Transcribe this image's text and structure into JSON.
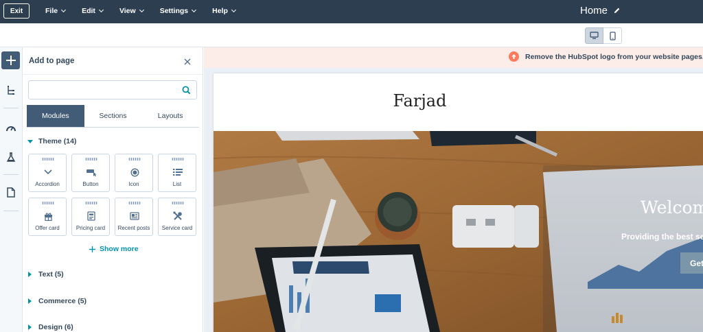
{
  "topbar": {
    "exit_label": "Exit",
    "menu": [
      {
        "label": "File"
      },
      {
        "label": "Edit"
      },
      {
        "label": "View"
      },
      {
        "label": "Settings"
      },
      {
        "label": "Help"
      }
    ],
    "page_title": "Home"
  },
  "panel": {
    "title": "Add to page",
    "search_value": "",
    "tabs": [
      {
        "label": "Modules",
        "active": true
      },
      {
        "label": "Sections",
        "active": false
      },
      {
        "label": "Layouts",
        "active": false
      }
    ],
    "theme_group": {
      "label": "Theme (14)",
      "expanded": true
    },
    "modules": [
      {
        "label": "Accordion",
        "icon": "chevron-down-icon"
      },
      {
        "label": "Button",
        "icon": "button-cursor-icon"
      },
      {
        "label": "Icon",
        "icon": "target-icon"
      },
      {
        "label": "List",
        "icon": "list-icon"
      },
      {
        "label": "Offer card",
        "icon": "gift-icon"
      },
      {
        "label": "Pricing card",
        "icon": "price-tag-icon"
      },
      {
        "label": "Recent posts",
        "icon": "posts-icon"
      },
      {
        "label": "Service card",
        "icon": "tools-icon"
      }
    ],
    "show_more_label": "Show more",
    "groups": [
      {
        "label": "Text (5)"
      },
      {
        "label": "Commerce (5)"
      },
      {
        "label": "Design (6)"
      }
    ]
  },
  "preview": {
    "banner_text": "Remove the HubSpot logo from your website pages.",
    "site_logo": "Farjad",
    "hero": {
      "title": "Welcome",
      "subtitle": "Providing the best services",
      "button_label": "Get"
    }
  },
  "colors": {
    "topbar": "#2d3e50",
    "accent": "#0091ae",
    "active_tab": "#425b76",
    "banner_bg": "#fdede8",
    "banner_icon": "#ff7a59"
  }
}
